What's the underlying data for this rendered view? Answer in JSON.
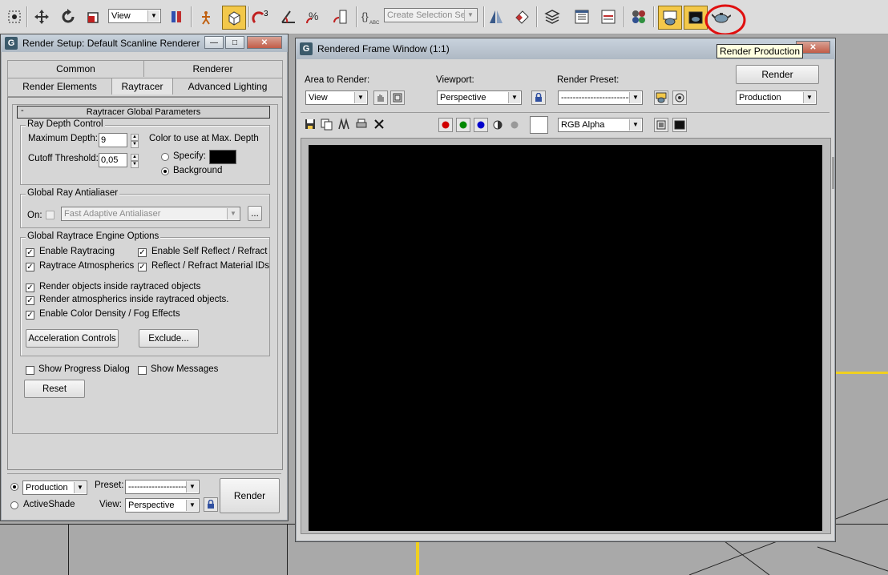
{
  "toolbar": {
    "view_dropdown": "View",
    "selection_set_placeholder": "Create Selection Set",
    "tooltip": "Render Production",
    "icons": [
      "select-region-icon",
      "move-icon",
      "rotate-icon",
      "scale-icon",
      "view-dropdown",
      "reference-coordinate-icon",
      "pivot-icon",
      "select-manipulate-icon",
      "snaps-3-icon",
      "angle-snap-icon",
      "percent-snap-icon",
      "spinner-snap-icon",
      "edit-named-selection-icon",
      "mirror-icon",
      "align-icon",
      "layer-manager-icon",
      "graphite-ribbon-icon",
      "curve-editor-icon",
      "material-editor-icon",
      "render-setup-icon",
      "rendered-frame-window-icon",
      "render-production-icon"
    ]
  },
  "render_setup": {
    "title": "Render Setup: Default Scanline Renderer",
    "tabs_row1": [
      "Common",
      "Renderer"
    ],
    "tabs_row2": [
      "Render Elements",
      "Raytracer",
      "Advanced Lighting"
    ],
    "rollout_title": "Raytracer Global Parameters",
    "rollout_toggle": "-",
    "ray_depth": {
      "title": "Ray Depth Control",
      "max_depth_label": "Maximum Depth:",
      "max_depth_value": "9",
      "cutoff_label": "Cutoff Threshold:",
      "cutoff_value": "0,05",
      "color_label": "Color to use at Max. Depth",
      "specify_label": "Specify:",
      "background_label": "Background",
      "selected": "Background"
    },
    "antialiaser": {
      "title": "Global Ray Antialiaser",
      "on_label": "On:",
      "dropdown": "Fast Adaptive Antialiaser",
      "more_button": "...",
      "enabled": false
    },
    "engine": {
      "title": "Global Raytrace Engine Options",
      "enable_raytracing": "Enable Raytracing",
      "enable_self_reflect": "Enable Self Reflect / Refract",
      "raytrace_atmospherics": "Raytrace Atmospherics",
      "reflect_refract_ids": "Reflect / Refract Material IDs",
      "render_objects_inside": "Render objects inside raytraced objects",
      "render_atmospherics_inside": "Render atmospherics inside raytraced objects.",
      "enable_color_density": "Enable Color Density / Fog Effects",
      "acceleration_button": "Acceleration Controls",
      "exclude_button": "Exclude..."
    },
    "show_progress": "Show Progress Dialog",
    "show_messages": "Show Messages",
    "reset_button": "Reset",
    "footer": {
      "production_label": "Production",
      "activeshade_label": "ActiveShade",
      "preset_label": "Preset:",
      "preset_value": "--------------------",
      "view_label": "View:",
      "view_value": "Perspective",
      "render_button": "Render"
    }
  },
  "frame_window": {
    "title": "Rendered Frame Window (1:1)",
    "area_label": "Area to Render:",
    "area_value": "View",
    "viewport_label": "Viewport:",
    "viewport_value": "Perspective",
    "preset_label": "Render Preset:",
    "preset_value": "-------------------------",
    "render_button": "Render",
    "mode_value": "Production",
    "channel_value": "RGB Alpha",
    "colors": {
      "red": "#d00000",
      "green": "#008800",
      "blue": "#0000cc",
      "render_bg": "#000000"
    }
  }
}
